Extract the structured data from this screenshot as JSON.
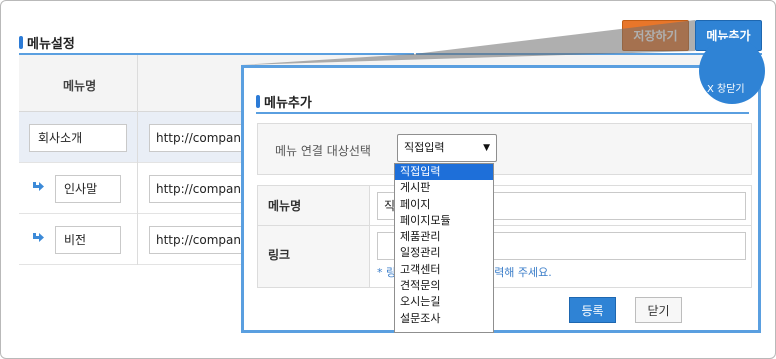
{
  "page": {
    "title": "메뉴설정",
    "save_label": "저장하기",
    "add_label": "메뉴추가",
    "column_menu_name": "메뉴명"
  },
  "rows": [
    {
      "name": "회사소개",
      "url": "http://company"
    },
    {
      "name": "인사말",
      "url": "http://company"
    },
    {
      "name": "비전",
      "url": "http://company"
    }
  ],
  "modal": {
    "title": "메뉴추가",
    "close_label": "X 창닫기",
    "select_label": "메뉴 연결 대상선택",
    "select_value": "직접입력",
    "menu_name_label": "메뉴명",
    "menu_name_value": "직접입력",
    "link_label": "링크",
    "link_value": "",
    "hint": "* 링크를 직접입력해서 입력해 주세요.",
    "register_label": "등록",
    "close_button_label": "닫기"
  },
  "dropdown_options": [
    "직접입력",
    "게시판",
    "페이지",
    "페이지모듈",
    "제품관리",
    "일정관리",
    "고객센터",
    "견적문의",
    "오시는길",
    "설문조사"
  ],
  "colors": {
    "accent": "#2f83d5",
    "save": "#e8762a",
    "line": "#5a9fe0"
  }
}
